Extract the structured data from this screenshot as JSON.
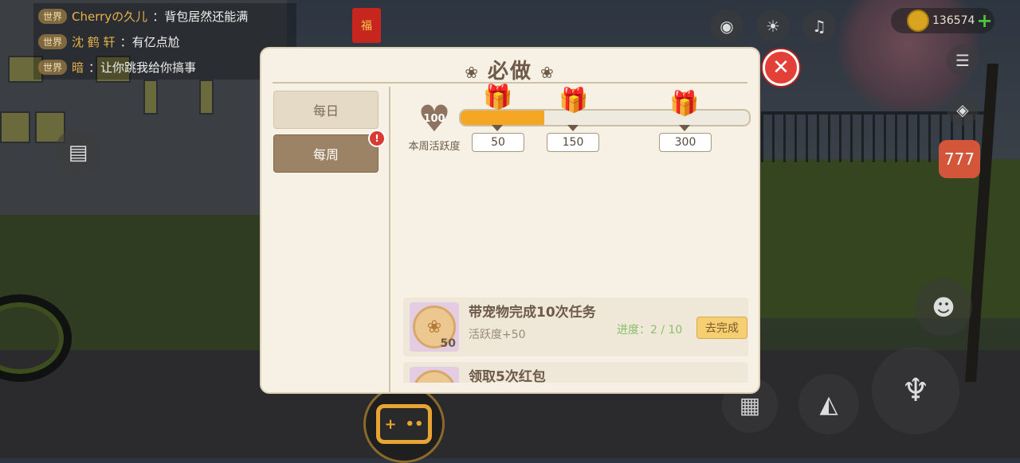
{
  "chat": [
    {
      "tag": "世界",
      "name": "Cherryの久儿",
      "message": "背包居然还能满"
    },
    {
      "tag": "世界",
      "name": "沈 鹤 轩",
      "message": "有亿点尬"
    },
    {
      "tag": "世界",
      "name": "暗",
      "message": "让你跳我给你搞事"
    }
  ],
  "hud": {
    "coins": "136574",
    "plus": "+"
  },
  "icons": {
    "camera": "camera-icon",
    "brightness": "sun-icon",
    "music": "music-icon",
    "menu": "menu-icon",
    "compass": "compass-icon"
  },
  "dialog": {
    "title": "必做",
    "tabs": [
      {
        "label": "每日",
        "selected": false
      },
      {
        "label": "每周",
        "selected": true,
        "badge": "!"
      }
    ],
    "activity": {
      "value": "100",
      "label": "本周活跃度",
      "fill_fraction": 0.29,
      "milestones": [
        "50",
        "150",
        "300"
      ]
    },
    "tasks": [
      {
        "icon_count": "50",
        "title": "带宠物完成10次任务",
        "reward": "活跃度+50",
        "progress": "进度：2 / 10",
        "action": "去完成"
      },
      {
        "title": "领取5次红包"
      }
    ]
  },
  "colors": {
    "panel": "#f6f1e4",
    "brown": "#6e5a48",
    "accent": "#f5a623",
    "close": "#e34037"
  }
}
